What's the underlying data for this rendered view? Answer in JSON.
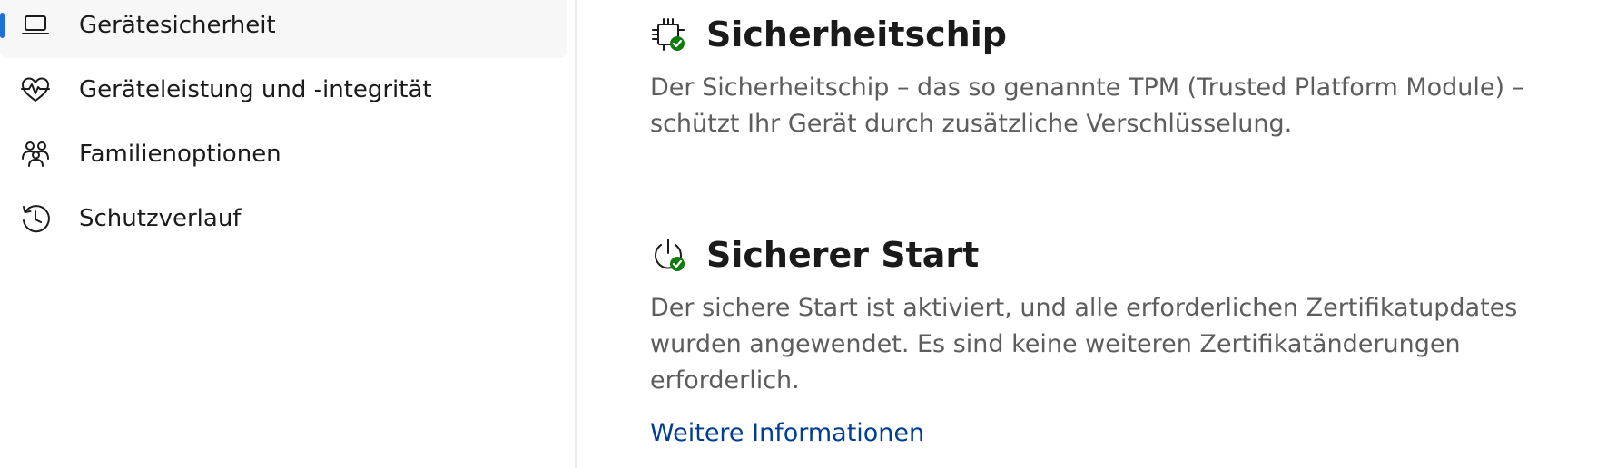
{
  "sidebar": {
    "items": [
      {
        "label": "Gerätesicherheit",
        "icon": "laptop-icon",
        "selected": true
      },
      {
        "label": "Geräteleistung und -integrität",
        "icon": "heart-pulse-icon",
        "selected": false
      },
      {
        "label": "Familienoptionen",
        "icon": "family-icon",
        "selected": false
      },
      {
        "label": "Schutzverlauf",
        "icon": "history-icon",
        "selected": false
      }
    ]
  },
  "main": {
    "security_chip": {
      "title": "Sicherheitschip",
      "icon": "security-chip-icon",
      "description": "Der Sicherheitschip – das so genannte TPM (Trusted Platform Module) – schützt Ihr Gerät durch zusätzliche Verschlüsselung."
    },
    "secure_boot": {
      "title": "Sicherer Start",
      "icon": "power-check-icon",
      "description": "Der sichere Start ist aktiviert, und alle erforderlichen Zertifikatupdates wurden angewendet. Es sind keine weiteren Zertifikatänderungen erforderlich.",
      "link": "Weitere Informationen"
    }
  },
  "colors": {
    "accent": "#1f6fd8",
    "link": "#003e92",
    "success": "#107c10",
    "text_secondary": "#5d5d5d"
  }
}
